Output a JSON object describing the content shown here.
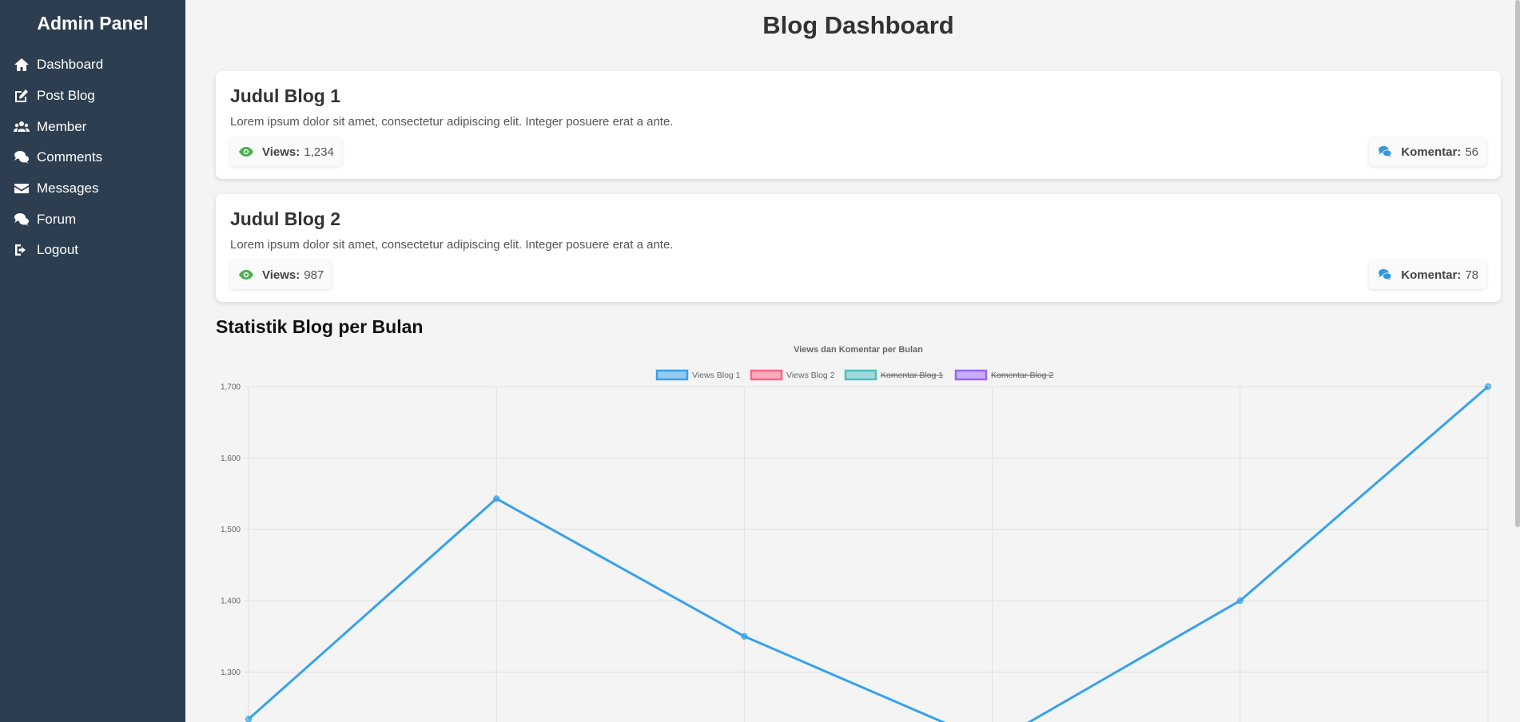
{
  "sidebar": {
    "brand": "Admin Panel",
    "items": [
      {
        "label": "Dashboard",
        "icon": "home-icon"
      },
      {
        "label": "Post Blog",
        "icon": "edit-icon"
      },
      {
        "label": "Member",
        "icon": "users-icon"
      },
      {
        "label": "Comments",
        "icon": "comments-icon"
      },
      {
        "label": "Messages",
        "icon": "envelope-icon"
      },
      {
        "label": "Forum",
        "icon": "comments-icon"
      },
      {
        "label": "Logout",
        "icon": "logout-icon"
      }
    ]
  },
  "page": {
    "title": "Blog Dashboard"
  },
  "blogs": [
    {
      "title": "Judul Blog 1",
      "excerpt": "Lorem ipsum dolor sit amet, consectetur adipiscing elit. Integer posuere erat a ante.",
      "views_label": "Views:",
      "views": "1,234",
      "comments_label": "Komentar:",
      "comments": "56"
    },
    {
      "title": "Judul Blog 2",
      "excerpt": "Lorem ipsum dolor sit amet, consectetur adipiscing elit. Integer posuere erat a ante.",
      "views_label": "Views:",
      "views": "987",
      "comments_label": "Komentar:",
      "comments": "78"
    }
  ],
  "stats": {
    "title": "Statistik Blog per Bulan"
  },
  "colors": {
    "sidebar_bg": "#2c3e50",
    "views_icon": "#4caf50",
    "comments_icon": "#3498db",
    "series_views_1": "#36a2eb",
    "series_views_2": "#ff6384",
    "series_komentar_1": "#4bc0c0",
    "series_komentar_2": "#9966ff"
  },
  "chart_data": {
    "type": "line",
    "title": "Views dan Komentar per Bulan",
    "legend_position": "top",
    "grid": true,
    "ylim": [
      1230,
      1700
    ],
    "yticks": [
      1300,
      1400,
      1500,
      1600,
      1700
    ],
    "ytick_labels": [
      "1,300",
      "1,400",
      "1,500",
      "1,600",
      "1,700"
    ],
    "x": [
      1,
      2,
      3,
      4,
      5,
      6
    ],
    "series": [
      {
        "name": "Views Blog 1",
        "values": [
          1234,
          1543,
          1350,
          1200,
          1400,
          1700
        ],
        "hidden": false,
        "color": "#36a2eb"
      },
      {
        "name": "Views Blog 2",
        "values": [],
        "hidden": false,
        "color": "#ff6384"
      },
      {
        "name": "Komentar Blog 1",
        "values": [],
        "hidden": true,
        "color": "#4bc0c0"
      },
      {
        "name": "Komentar Blog 2",
        "values": [],
        "hidden": true,
        "color": "#9966ff"
      }
    ]
  }
}
